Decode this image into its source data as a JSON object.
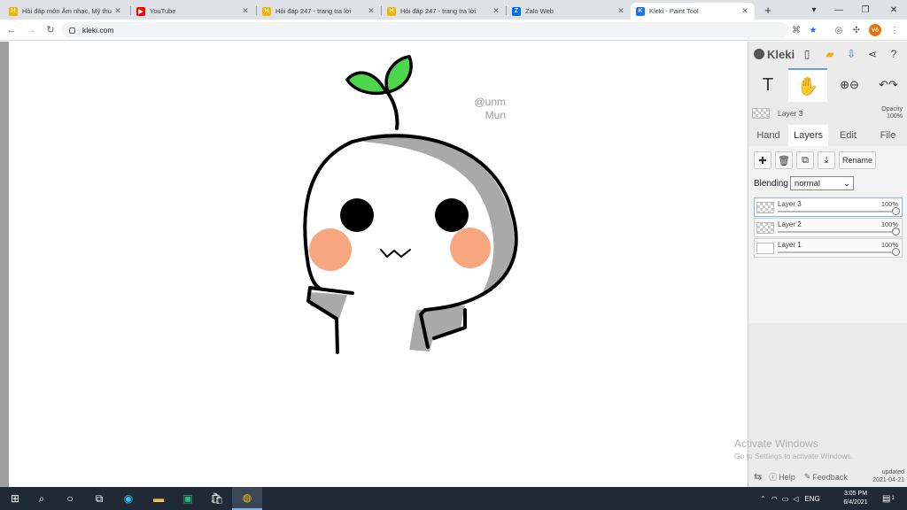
{
  "browser": {
    "tabs": [
      {
        "title": "Hỏi đáp môn Âm nhạc, Mỹ thu",
        "favicon_color": "#f4b400",
        "favicon_glyph": "H",
        "favicon": "hoidap-icon"
      },
      {
        "title": "YouTube",
        "favicon_color": "#ff0000",
        "favicon_glyph": "▶",
        "favicon": "youtube-icon"
      },
      {
        "title": "Hỏi đáp 247 - trang tra lời",
        "favicon_color": "#f4b400",
        "favicon_glyph": "H",
        "favicon": "hoidap-icon"
      },
      {
        "title": "Hỏi đáp 247 - trang tra lời",
        "favicon_color": "#f4b400",
        "favicon_glyph": "H",
        "favicon": "hoidap-icon"
      },
      {
        "title": "Zalo Web",
        "favicon_color": "#0068ff",
        "favicon_glyph": "Z",
        "favicon": "zalo-icon"
      },
      {
        "title": "Kleki - Paint Tool",
        "favicon_color": "#1a73e8",
        "favicon_glyph": "K",
        "favicon": "kleki-icon",
        "active": true
      }
    ],
    "new_tab": "+",
    "close_glyph": "✕",
    "window_controls": {
      "menu": "▾",
      "minimize": "—",
      "maximize": "❐",
      "close": "✕"
    },
    "url": "kleki.com",
    "profile_initials": "Võ"
  },
  "canvas": {
    "watermark_line1": "@unm",
    "watermark_line2": "Mun"
  },
  "kleki": {
    "logo": "Kleki",
    "current_layer": "Layer 3",
    "opacity_label": "Opacity",
    "opacity_value": "100%",
    "tabs": [
      "Hand",
      "Layers",
      "Edit",
      "File"
    ],
    "active_tab": "Layers",
    "rename_label": "Rename",
    "blending_label": "Blending",
    "blending_value": "normal",
    "layers": [
      {
        "name": "Layer 3",
        "opacity": "100%",
        "opacity_fraction": 1.0,
        "active": true
      },
      {
        "name": "Layer 2",
        "opacity": "100%",
        "opacity_fraction": 1.0
      },
      {
        "name": "Layer 1",
        "opacity": "100%",
        "opacity_fraction": 1.0
      }
    ],
    "help_label": "Help",
    "feedback_label": "Feedback",
    "updated_label": "updated",
    "updated_date": "2021-04-21"
  },
  "windows": {
    "activate_title": "Activate Windows",
    "activate_subtitle": "Go to Settings to activate Windows.",
    "language": "ENG",
    "time": "3:05 PM",
    "date": "6/4/2021",
    "notification_count": "1"
  }
}
